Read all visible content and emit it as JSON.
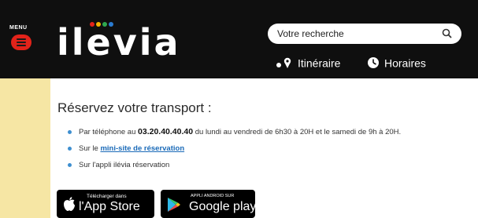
{
  "header": {
    "menu_label": "MENU",
    "logo_text": "ilevia",
    "search": {
      "placeholder": "Votre recherche"
    },
    "nav": {
      "itineraire_label": "Itinéraire",
      "horaires_label": "Horaires"
    }
  },
  "main": {
    "title": "Réservez votre transport :",
    "options": {
      "phone_prefix": "Par téléphone au ",
      "phone_number": "03.20.40.40.40",
      "phone_suffix": " du lundi au vendredi de 6h30 à 20H et le samedi de 9h à 20H.",
      "site_prefix": "Sur le ",
      "site_link": "mini-site de réservation",
      "app_text": "Sur l'appli ilévia réservation"
    },
    "badges": {
      "apple_small": "Télécharger dans",
      "apple_big": "l'App Store",
      "google_small": "APPLI ANDROID SUR",
      "google_big": "Google play"
    }
  },
  "colors": {
    "page_background": "#f6e6a4",
    "header_background": "#0f0f0f",
    "menu_accent": "#e2231a",
    "link": "#1a6ab8",
    "bullet": "#3e8fd0"
  }
}
